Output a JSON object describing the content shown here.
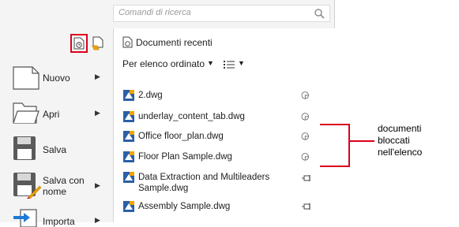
{
  "search": {
    "placeholder": "Comandi di ricerca"
  },
  "menu": {
    "items": [
      {
        "label": "Nuovo"
      },
      {
        "label": "Apri"
      },
      {
        "label": "Salva"
      },
      {
        "label": "Salva con nome"
      },
      {
        "label": "Importa"
      }
    ]
  },
  "recent": {
    "title": "Documenti recenti",
    "sort_label": "Per elenco ordinato"
  },
  "files": [
    {
      "name": "2.dwg",
      "state": "locked"
    },
    {
      "name": "underlay_content_tab.dwg",
      "state": "locked"
    },
    {
      "name": "Office floor_plan.dwg",
      "state": "locked"
    },
    {
      "name": "Floor Plan Sample.dwg",
      "state": "locked"
    },
    {
      "name": "Data Extraction and Multileaders Sample.dwg",
      "state": "pinnable"
    },
    {
      "name": "Assembly Sample.dwg",
      "state": "pinnable"
    }
  ],
  "annotation": {
    "line1": "documenti",
    "line2": "bloccati",
    "line3": "nell'elenco"
  },
  "colors": {
    "highlight": "#d9001b",
    "dwg_blue": "#2b5fa6"
  }
}
